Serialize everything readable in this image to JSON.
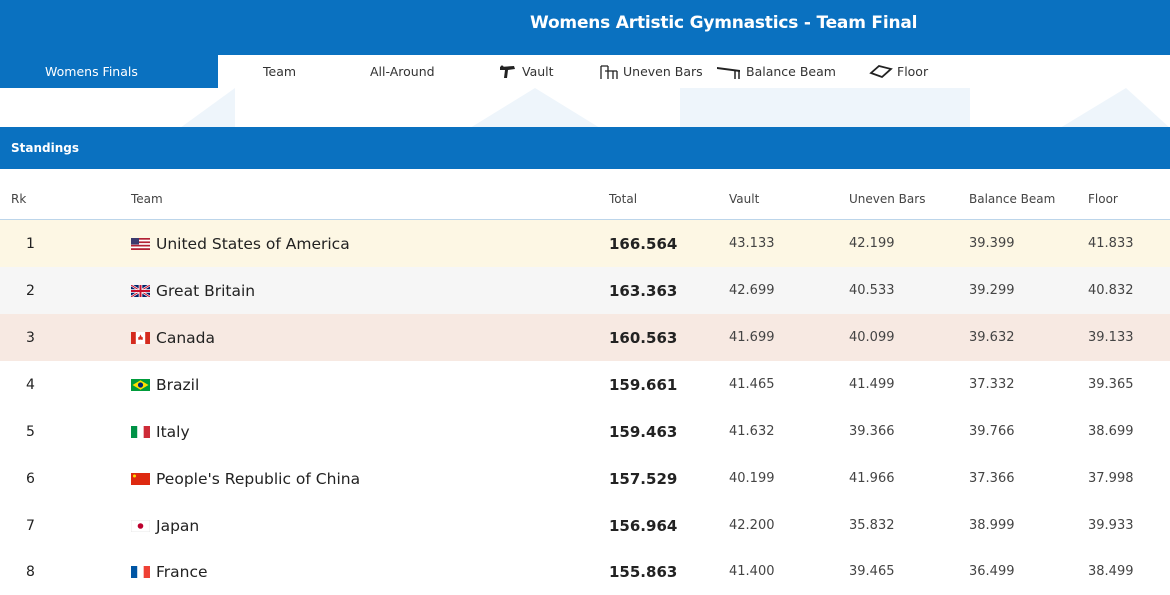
{
  "header": {
    "title": "Womens Artistic Gymnastics - Team Final"
  },
  "nav": {
    "active": "Womens Finals",
    "tabs": [
      {
        "label": "Team",
        "icon": ""
      },
      {
        "label": "All-Around",
        "icon": ""
      },
      {
        "label": "Vault",
        "icon": "vault-icon"
      },
      {
        "label": "Uneven Bars",
        "icon": "uneven-bars-icon"
      },
      {
        "label": "Balance Beam",
        "icon": "balance-beam-icon"
      },
      {
        "label": "Floor",
        "icon": "floor-icon"
      }
    ]
  },
  "section": {
    "title": "Standings"
  },
  "columns": {
    "rk": "Rk",
    "team": "Team",
    "total": "Total",
    "vault": "Vault",
    "bars": "Uneven Bars",
    "beam": "Balance Beam",
    "floor": "Floor"
  },
  "colors": {
    "brand": "#0a71c0",
    "gold": "#fdf7e4",
    "silver": "#f6f6f6",
    "bronze": "#f7e9e2"
  },
  "rows": [
    {
      "rk": "1",
      "team": "United States of America",
      "flag": "usa-flag-icon",
      "total": "166.564",
      "vault": "43.133",
      "bars": "42.199",
      "beam": "39.399",
      "floor": "41.833",
      "bg": "#fdf7e4"
    },
    {
      "rk": "2",
      "team": "Great Britain",
      "flag": "great-britain-flag-icon",
      "total": "163.363",
      "vault": "42.699",
      "bars": "40.533",
      "beam": "39.299",
      "floor": "40.832",
      "bg": "#f6f6f6"
    },
    {
      "rk": "3",
      "team": "Canada",
      "flag": "canada-flag-icon",
      "total": "160.563",
      "vault": "41.699",
      "bars": "40.099",
      "beam": "39.632",
      "floor": "39.133",
      "bg": "#f7e9e2"
    },
    {
      "rk": "4",
      "team": "Brazil",
      "flag": "brazil-flag-icon",
      "total": "159.661",
      "vault": "41.465",
      "bars": "41.499",
      "beam": "37.332",
      "floor": "39.365",
      "bg": "#ffffff"
    },
    {
      "rk": "5",
      "team": "Italy",
      "flag": "italy-flag-icon",
      "total": "159.463",
      "vault": "41.632",
      "bars": "39.366",
      "beam": "39.766",
      "floor": "38.699",
      "bg": "#ffffff"
    },
    {
      "rk": "6",
      "team": "People's Republic of China",
      "flag": "china-flag-icon",
      "total": "157.529",
      "vault": "40.199",
      "bars": "41.966",
      "beam": "37.366",
      "floor": "37.998",
      "bg": "#ffffff"
    },
    {
      "rk": "7",
      "team": "Japan",
      "flag": "japan-flag-icon",
      "total": "156.964",
      "vault": "42.200",
      "bars": "35.832",
      "beam": "38.999",
      "floor": "39.933",
      "bg": "#ffffff"
    },
    {
      "rk": "8",
      "team": "France",
      "flag": "france-flag-icon",
      "total": "155.863",
      "vault": "41.400",
      "bars": "39.465",
      "beam": "36.499",
      "floor": "38.499",
      "bg": "#ffffff"
    }
  ]
}
